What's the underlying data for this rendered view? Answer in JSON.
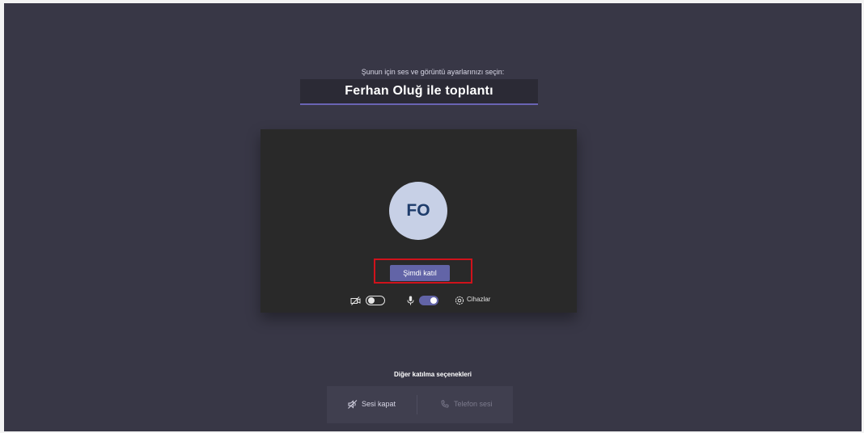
{
  "prompt": "Şunun için ses ve görüntü ayarlarınızı seçin:",
  "meeting_title": "Ferhan Oluğ ile toplantı",
  "avatar_initials": "FO",
  "join_button_label": "Şimdi katıl",
  "controls": {
    "camera_icon": "camera-off-icon",
    "camera_toggle": "off",
    "mic_icon": "microphone-icon",
    "mic_toggle": "on",
    "devices_icon": "gear-icon",
    "devices_label": "Cihazlar"
  },
  "other_options": {
    "title": "Diğer katılma seçenekleri",
    "mute_audio_label": "Sesi kapat",
    "phone_audio_label": "Telefon sesi"
  },
  "colors": {
    "background": "#383746",
    "accent": "#6264a7",
    "preview_bg": "#292929",
    "avatar_bg": "#c7d0e6",
    "highlight": "#d0121b"
  }
}
